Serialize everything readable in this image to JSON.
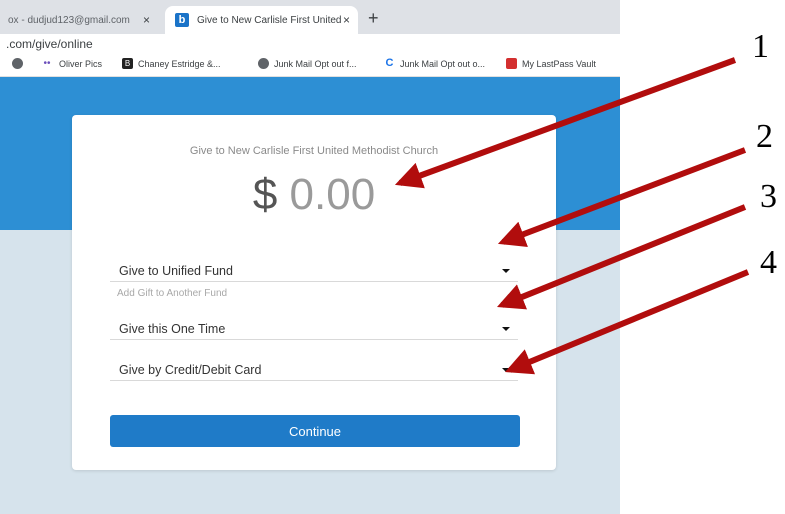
{
  "browser": {
    "tabs": [
      {
        "label": "ox - dudjud123@gmail.com",
        "close": "×"
      },
      {
        "label": "Give to New Carlisle First United",
        "favicon": "b",
        "close": "×"
      }
    ],
    "new_tab": "+",
    "url": ".com/give/online",
    "bookmarks": [
      {
        "icon": "globe-icon",
        "label": ""
      },
      {
        "icon": "dots-icon",
        "label": "Oliver Pics"
      },
      {
        "icon": "b-square-icon",
        "glyph": "B",
        "label": "Chaney Estridge &..."
      },
      {
        "icon": "globe-icon",
        "label": "Junk Mail Opt out f..."
      },
      {
        "icon": "c-icon",
        "glyph": "C",
        "label": "Junk Mail Opt out o..."
      },
      {
        "icon": "lastpass-icon",
        "label": "My LastPass Vault"
      }
    ]
  },
  "form": {
    "title": "Give to New Carlisle First United Methodist Church",
    "currency": "$",
    "amount": "0.00",
    "fund_select": "Give to Unified Fund",
    "add_fund_link": "Add Gift to Another Fund",
    "frequency_select": "Give this One Time",
    "payment_select": "Give by Credit/Debit Card",
    "continue_label": "Continue"
  },
  "colors": {
    "banner": "#2d8fd4",
    "button": "#1f7bc8",
    "arrow": "#b10d0d",
    "background": "#d6e3ec"
  },
  "annotations": {
    "numbers": [
      "1",
      "2",
      "3",
      "4"
    ]
  }
}
